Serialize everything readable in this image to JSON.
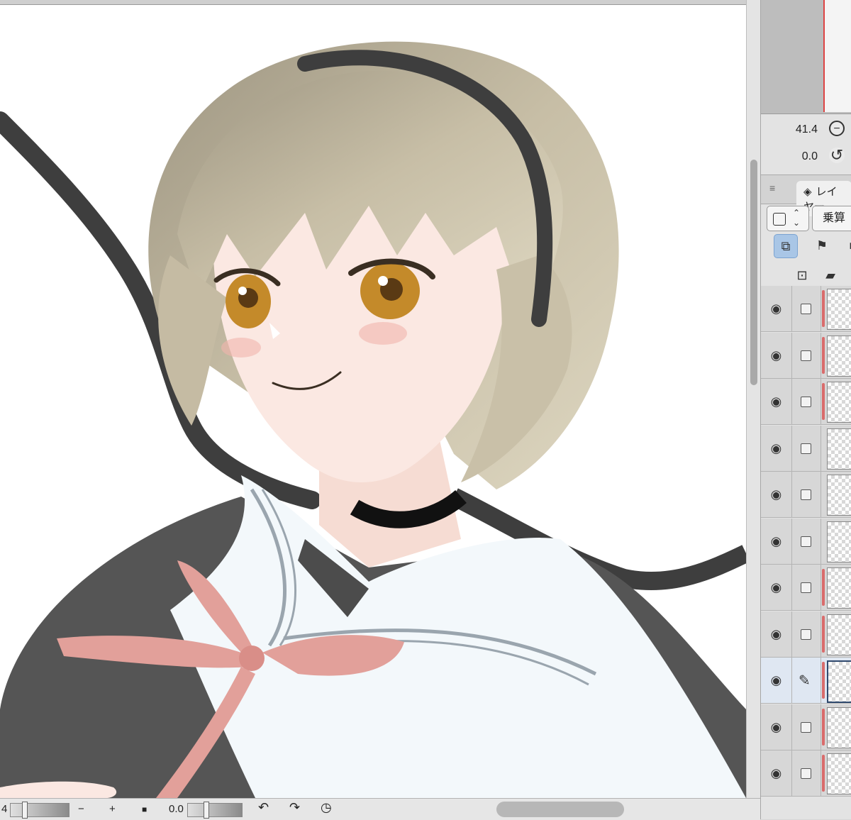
{
  "navigator": {
    "zoom": "41.4",
    "angle": "0.0",
    "zoom_out_icon": "minus-circle-icon",
    "reset_rotation_icon": "rotate-reset-icon"
  },
  "layer_panel": {
    "menu_icon": "≡",
    "tab_label": "レイヤー",
    "blend_mode": "乗算",
    "layers": [
      {
        "visible": true,
        "editing": false,
        "color": "#d96c6c"
      },
      {
        "visible": true,
        "editing": false,
        "color": "#d96c6c"
      },
      {
        "visible": true,
        "editing": false,
        "color": "#d96c6c"
      },
      {
        "visible": true,
        "editing": false,
        "color": "#d8d8d8"
      },
      {
        "visible": true,
        "editing": false,
        "color": "#d8d8d8"
      },
      {
        "visible": true,
        "editing": false,
        "color": "#d8d8d8"
      },
      {
        "visible": true,
        "editing": false,
        "color": "#d96c6c"
      },
      {
        "visible": true,
        "editing": false,
        "color": "#d96c6c"
      },
      {
        "visible": true,
        "editing": true,
        "color": "#d96c6c"
      },
      {
        "visible": true,
        "editing": false,
        "color": "#d96c6c"
      },
      {
        "visible": true,
        "editing": false,
        "color": "#d96c6c"
      }
    ]
  },
  "bottom_bar": {
    "brush_size": "4",
    "minus": "−",
    "plus": "+",
    "rotation": "0.0",
    "undo_icon": "↶",
    "redo_icon": "↷",
    "timer_icon": "◷"
  },
  "colors": {
    "hair": "#b7ad94",
    "ribbon": "#e2a09a",
    "uniform": "#555555",
    "collar": "#f3f8fb",
    "band": "#3e3e3e",
    "skin": "#fbe8e2",
    "eye": "#c48a2a",
    "accent": "#a9c6e6"
  }
}
